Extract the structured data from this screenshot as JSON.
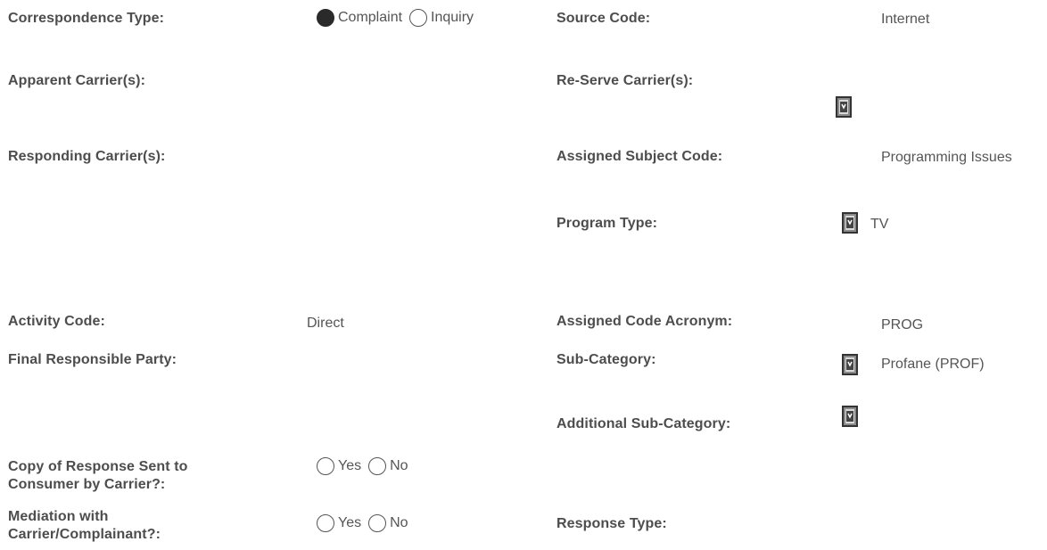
{
  "form": {
    "correspondence_type": {
      "label": "Correspondence Type:",
      "options": [
        {
          "label": "Complaint",
          "selected": true
        },
        {
          "label": "Inquiry",
          "selected": false
        }
      ]
    },
    "source_code": {
      "label": "Source Code:",
      "value": "Internet"
    },
    "apparent_carriers": {
      "label": "Apparent Carrier(s):"
    },
    "reserve_carriers": {
      "label": "Re-Serve Carrier(s):"
    },
    "responding_carriers": {
      "label": "Responding Carrier(s):"
    },
    "assigned_subject_code": {
      "label": "Assigned Subject Code:",
      "value": "Programming Issues"
    },
    "program_type": {
      "label": "Program Type:",
      "value": "TV"
    },
    "activity_code": {
      "label": "Activity Code:",
      "value": "Direct"
    },
    "assigned_code_acronym": {
      "label": "Assigned Code Acronym:",
      "value": "PROG"
    },
    "final_responsible_party": {
      "label": "Final Responsible Party:"
    },
    "sub_category": {
      "label": "Sub-Category:",
      "value": "Profane (PROF)"
    },
    "additional_sub_category": {
      "label": "Additional Sub-Category:"
    },
    "copy_of_response": {
      "label_line1": "Copy of Response Sent to",
      "label_line2": "Consumer by Carrier?:",
      "options": [
        {
          "label": "Yes",
          "selected": false
        },
        {
          "label": "No",
          "selected": false
        }
      ]
    },
    "mediation": {
      "label_line1": "Mediation with",
      "label_line2": "Carrier/Complainant?:",
      "options": [
        {
          "label": "Yes",
          "selected": false
        },
        {
          "label": "No",
          "selected": false
        }
      ]
    },
    "response_type": {
      "label": "Response Type:"
    }
  },
  "icons": {
    "lookup": "lookup-icon"
  }
}
